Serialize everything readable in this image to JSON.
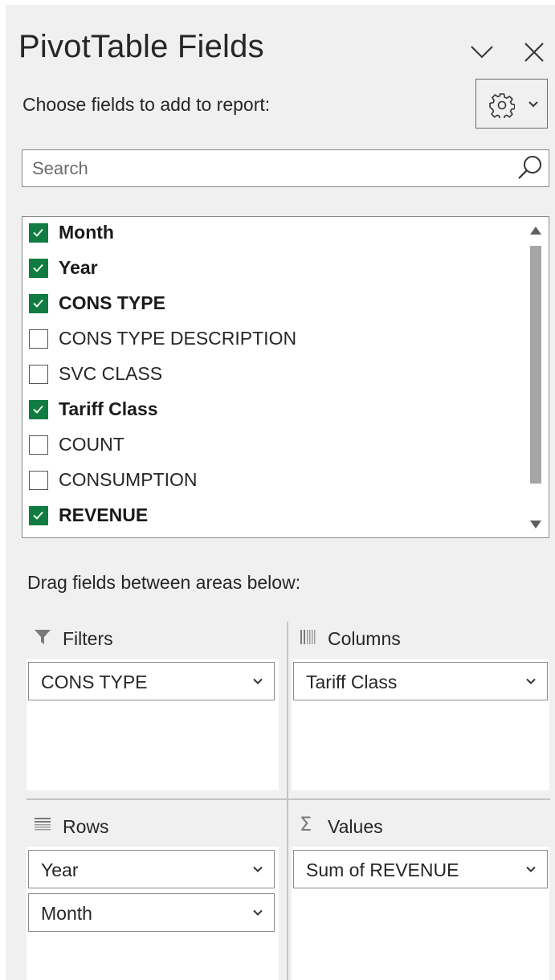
{
  "pane": {
    "title": "PivotTable Fields",
    "subtitle": "Choose fields to add to report:",
    "icons": {
      "collapse": "chevron-down-icon",
      "close": "close-icon",
      "settings": "gear-icon"
    }
  },
  "search": {
    "placeholder": "Search",
    "value": ""
  },
  "fields": [
    {
      "label": "Month",
      "checked": true
    },
    {
      "label": "Year",
      "checked": true
    },
    {
      "label": "CONS TYPE",
      "checked": true
    },
    {
      "label": "CONS TYPE DESCRIPTION",
      "checked": false
    },
    {
      "label": "SVC CLASS",
      "checked": false
    },
    {
      "label": "Tariff Class",
      "checked": true
    },
    {
      "label": "COUNT",
      "checked": false
    },
    {
      "label": "CONSUMPTION",
      "checked": false
    },
    {
      "label": "REVENUE",
      "checked": true
    }
  ],
  "areas": {
    "instruction": "Drag fields between areas below:",
    "filters": {
      "label": "Filters",
      "items": [
        "CONS TYPE"
      ]
    },
    "columns": {
      "label": "Columns",
      "items": [
        "Tariff Class"
      ]
    },
    "rows": {
      "label": "Rows",
      "items": [
        "Year",
        "Month"
      ]
    },
    "values": {
      "label": "Values",
      "items": [
        "Sum of REVENUE"
      ]
    }
  },
  "colors": {
    "accent_checked": "#107c41",
    "pane_background": "#f0f0f0"
  }
}
